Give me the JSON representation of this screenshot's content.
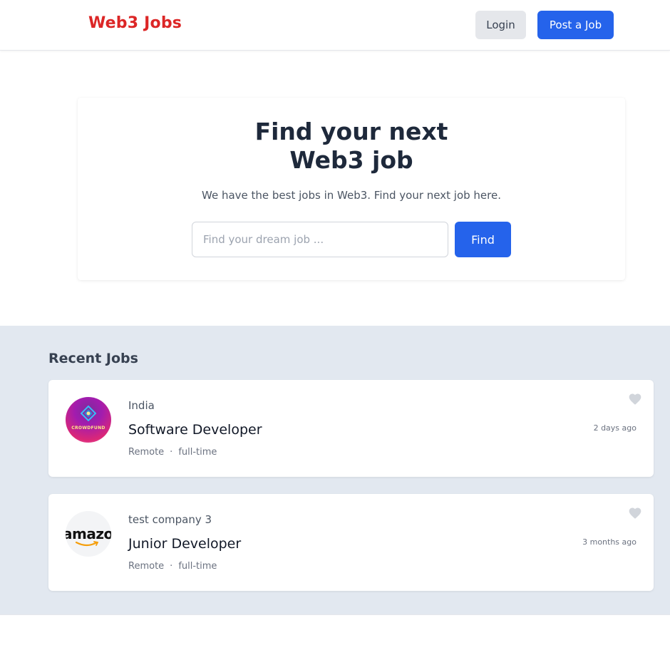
{
  "header": {
    "brand": "Web3 Jobs",
    "login_label": "Login",
    "post_job_label": "Post a Job"
  },
  "hero": {
    "title_line1": "Find your next",
    "title_line2": "Web3 job",
    "subtitle": "We have the best jobs in Web3. Find your next job here.",
    "search_placeholder": "Find your dream job ...",
    "find_label": "Find"
  },
  "recent": {
    "title": "Recent Jobs",
    "jobs": [
      {
        "company": "India",
        "title": "Software Developer",
        "location": "Remote",
        "separator": "·",
        "type": "full-time",
        "posted": "2 days ago",
        "logo_text": "CROWDFUND"
      },
      {
        "company": "test company 3",
        "title": "Junior Developer",
        "location": "Remote",
        "separator": "·",
        "type": "full-time",
        "posted": "3 months ago",
        "logo_text": "amazon"
      }
    ]
  },
  "colors": {
    "brand": "#dc2626",
    "primary": "#2563eb",
    "section_bg": "#e2e8f0"
  }
}
